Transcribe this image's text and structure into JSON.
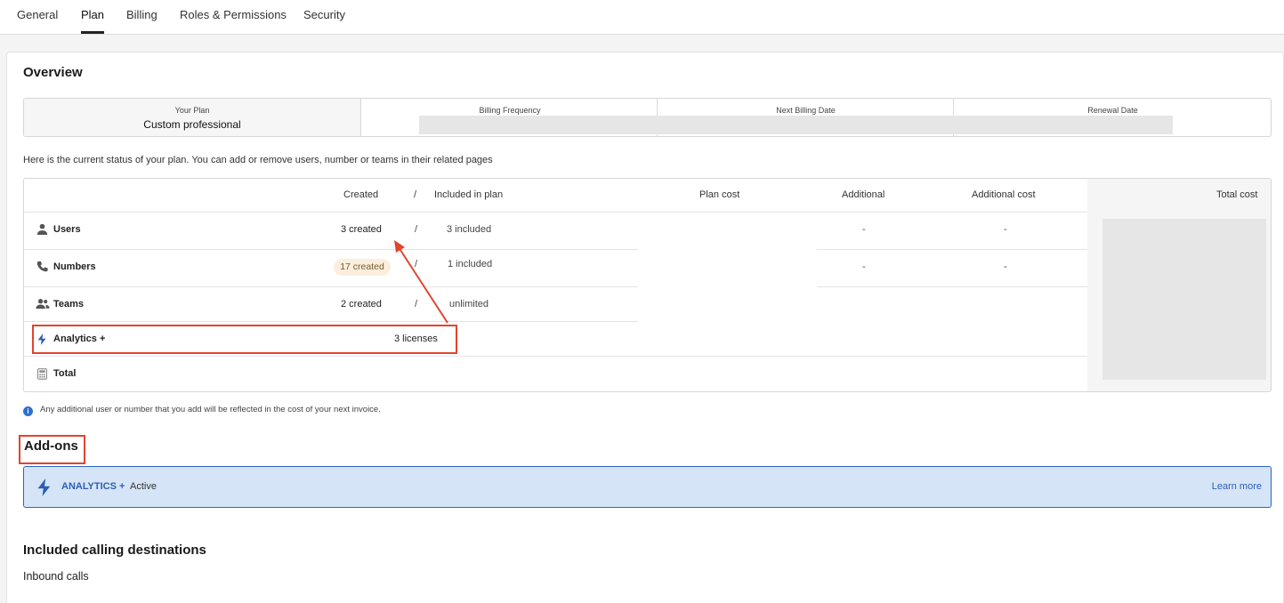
{
  "tabs": [
    {
      "label": "General"
    },
    {
      "label": "Plan"
    },
    {
      "label": "Billing"
    },
    {
      "label": "Roles & Permissions"
    },
    {
      "label": "Security"
    }
  ],
  "active_tab": "Plan",
  "overview": {
    "title": "Overview",
    "summary": [
      {
        "label": "Your Plan",
        "value": "Custom professional"
      },
      {
        "label": "Billing Frequency",
        "value": ""
      },
      {
        "label": "Next Billing Date",
        "value": ""
      },
      {
        "label": "Renewal Date",
        "value": ""
      }
    ],
    "status_text": "Here is the current status of your plan. You can add or remove users, number or teams in their related pages"
  },
  "table": {
    "headers": {
      "created": "Created",
      "slash": "/",
      "included": "Included in plan",
      "plan_cost": "Plan cost",
      "additional": "Additional",
      "additional_cost": "Additional cost",
      "total_cost": "Total cost"
    },
    "rows": [
      {
        "icon": "user-icon",
        "label": "Users",
        "created": "3 created",
        "slash": "/",
        "included": "3 included",
        "additional": "-",
        "additional_cost": "-"
      },
      {
        "icon": "phone-icon",
        "label": "Numbers",
        "created": "17 created",
        "slash": "/",
        "included": "1 included",
        "additional": "-",
        "additional_cost": "-"
      },
      {
        "icon": "team-icon",
        "label": "Teams",
        "created": "2 created",
        "slash": "/",
        "included": "unlimited"
      },
      {
        "icon": "bolt-icon",
        "label": "Analytics +",
        "created": "3 licenses"
      },
      {
        "icon": "calculator-icon",
        "label": "Total"
      }
    ]
  },
  "info_note": "Any additional user or number that you add will be reflected in the cost of your next invoice.",
  "addons": {
    "title": "Add-ons",
    "items": [
      {
        "name": "ANALYTICS +",
        "status": "Active",
        "link": "Learn more"
      }
    ]
  },
  "calling": {
    "title": "Included calling destinations",
    "subtitle": "Inbound calls"
  },
  "colors": {
    "accent": "#2c5fb4",
    "highlight": "#e0452e",
    "badge_bg": "#fbeedd",
    "addon_bg": "#d6e4f8"
  }
}
